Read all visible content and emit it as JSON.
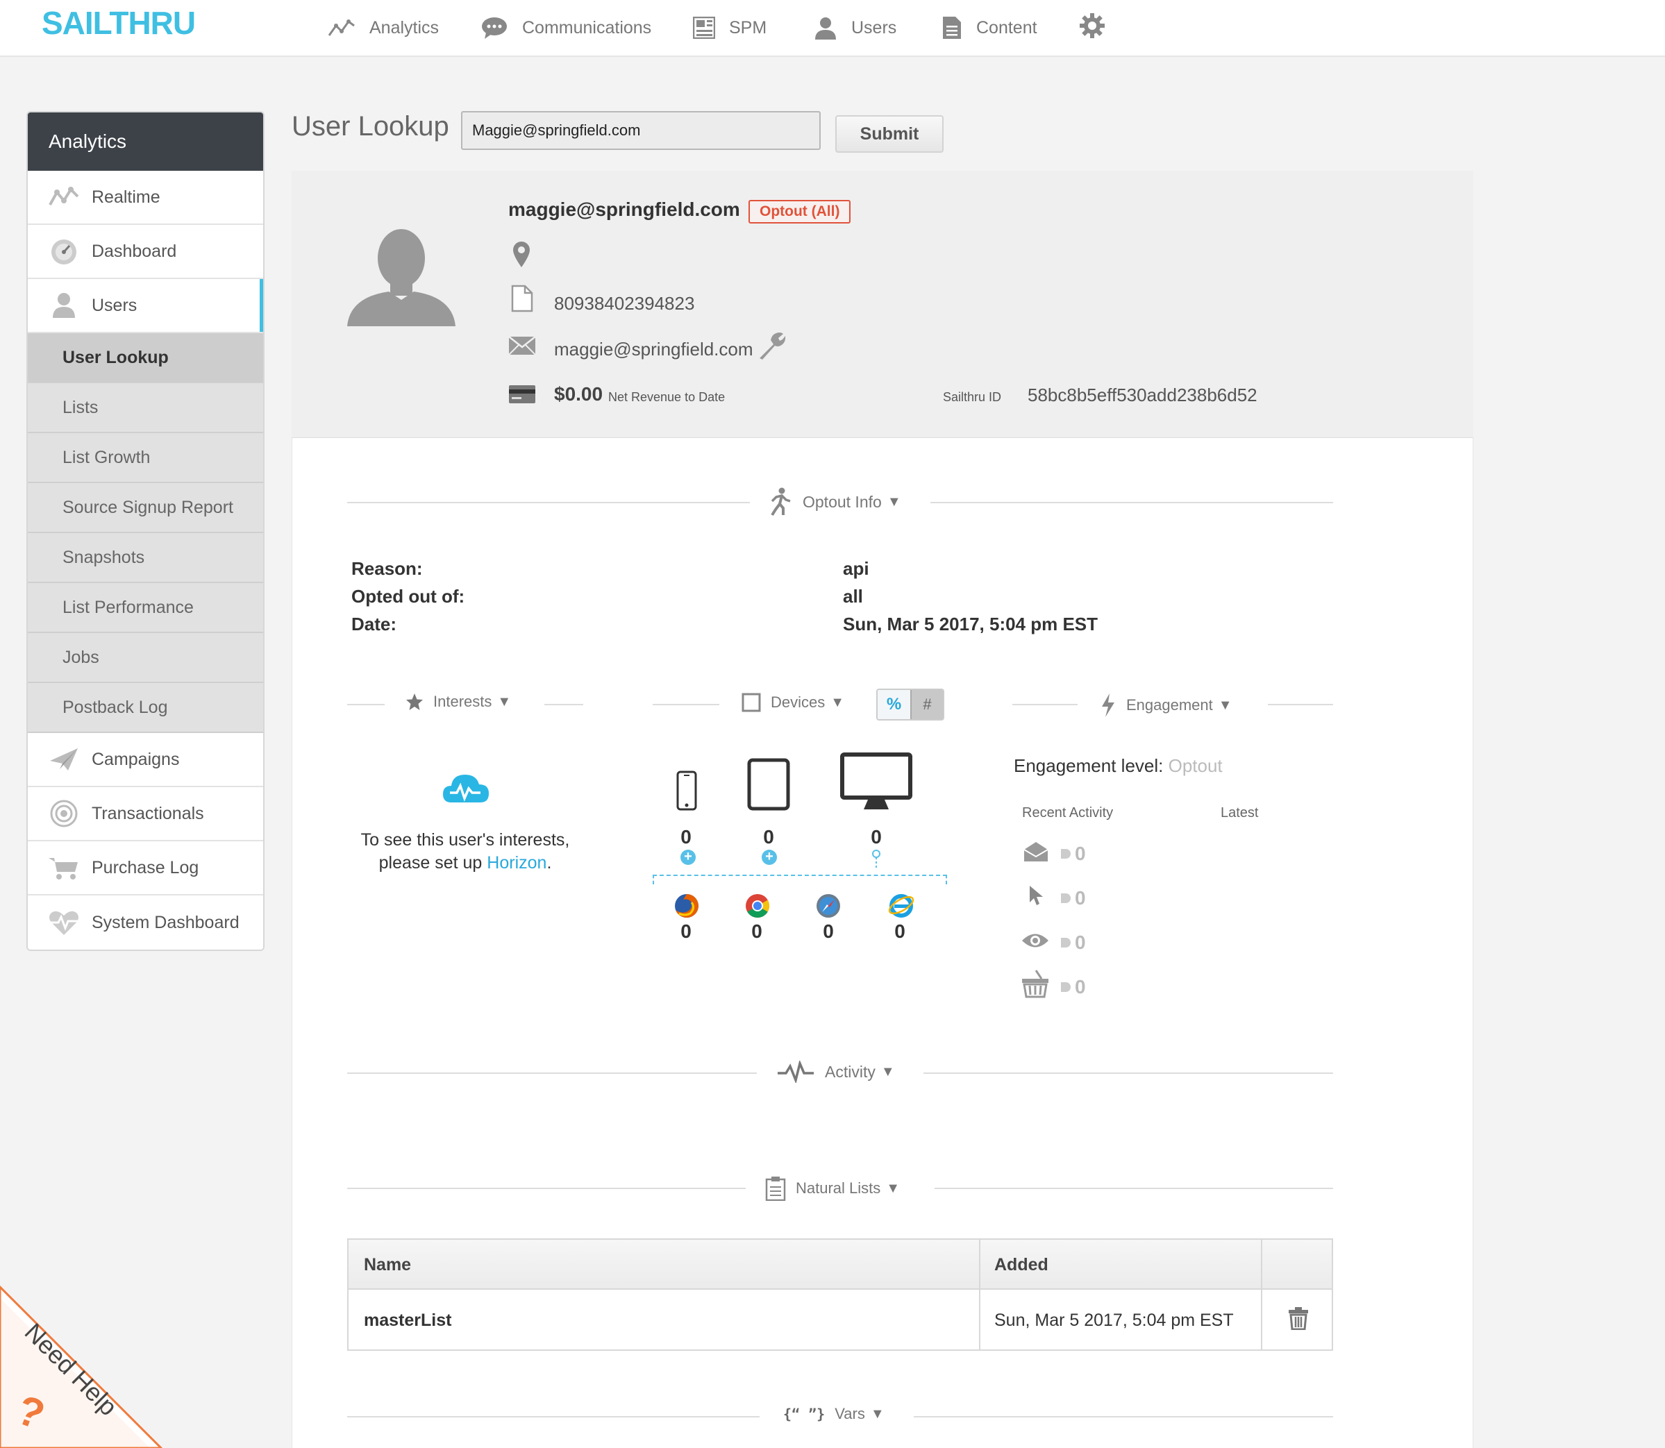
{
  "brand": {
    "logo": "SAILTHRU",
    "accent": "#3fbfe2",
    "optout_color": "#e0533a"
  },
  "topnav": {
    "items": [
      {
        "label": "Analytics",
        "icon": "analytics-icon"
      },
      {
        "label": "Communications",
        "icon": "chat-icon"
      },
      {
        "label": "SPM",
        "icon": "spm-icon"
      },
      {
        "label": "Users",
        "icon": "user-icon"
      },
      {
        "label": "Content",
        "icon": "document-icon"
      }
    ],
    "settings_icon": "gear-icon"
  },
  "sidebar": {
    "header": "Analytics",
    "items": [
      {
        "label": "Realtime",
        "icon": "realtime-icon"
      },
      {
        "label": "Dashboard",
        "icon": "dashboard-icon"
      },
      {
        "label": "Users",
        "icon": "user-icon",
        "active": true
      }
    ],
    "sub_items": [
      {
        "label": "User Lookup",
        "active": true
      },
      {
        "label": "Lists"
      },
      {
        "label": "List Growth"
      },
      {
        "label": "Source Signup Report"
      },
      {
        "label": "Snapshots"
      },
      {
        "label": "List Performance"
      },
      {
        "label": "Jobs"
      },
      {
        "label": "Postback Log"
      }
    ],
    "items2": [
      {
        "label": "Campaigns",
        "icon": "paper-plane-icon"
      },
      {
        "label": "Transactionals",
        "icon": "target-icon"
      },
      {
        "label": "Purchase Log",
        "icon": "cart-icon"
      },
      {
        "label": "System Dashboard",
        "icon": "heartbeat-icon"
      }
    ]
  },
  "lookup": {
    "title": "User Lookup",
    "input_value": "Maggie@springfield.com",
    "submit_label": "Submit"
  },
  "profile": {
    "email_heading": "maggie@springfield.com",
    "optout_badge": "Optout (All)",
    "phone_id": "80938402394823",
    "email": "maggie@springfield.com",
    "revenue": "$0.00",
    "revenue_label": "Net Revenue to Date",
    "sailthru_id_label": "Sailthru ID",
    "sailthru_id": "58bc8b5eff530add238b6d52"
  },
  "optout_info": {
    "title": "Optout Info",
    "rows": [
      {
        "label": "Reason:",
        "value": "api"
      },
      {
        "label": "Opted out of:",
        "value": "all"
      },
      {
        "label": "Date:",
        "value": "Sun, Mar 5 2017, 5:04 pm EST"
      }
    ]
  },
  "interests": {
    "title": "Interests",
    "message": "To see this user's interests,",
    "message2": "please set up ",
    "link": "Horizon",
    "suffix": "."
  },
  "devices": {
    "title": "Devices",
    "toggle_percent": "%",
    "toggle_count": "#",
    "device_counts": [
      {
        "name": "phone",
        "value": "0"
      },
      {
        "name": "tablet",
        "value": "0"
      },
      {
        "name": "desktop",
        "value": "0"
      }
    ],
    "browser_counts": [
      {
        "name": "firefox",
        "value": "0"
      },
      {
        "name": "chrome",
        "value": "0"
      },
      {
        "name": "safari",
        "value": "0"
      },
      {
        "name": "ie",
        "value": "0"
      }
    ]
  },
  "engagement": {
    "title": "Engagement",
    "level_label": "Engagement level:",
    "level_value": "Optout",
    "col_recent": "Recent Activity",
    "col_latest": "Latest",
    "activity": [
      {
        "icon": "envelope-open-icon",
        "value": "0"
      },
      {
        "icon": "cursor-icon",
        "value": "0"
      },
      {
        "icon": "eye-icon",
        "value": "0"
      },
      {
        "icon": "basket-icon",
        "value": "0"
      }
    ]
  },
  "activity": {
    "title": "Activity"
  },
  "natural_lists": {
    "title": "Natural Lists",
    "columns": [
      "Name",
      "Added"
    ],
    "rows": [
      {
        "name": "masterList",
        "added": "Sun, Mar 5 2017, 5:04 pm EST"
      }
    ]
  },
  "vars": {
    "title": "Vars",
    "icon_text": "{“ ”}"
  },
  "help": {
    "label": "Need Help",
    "symbol": "?"
  }
}
